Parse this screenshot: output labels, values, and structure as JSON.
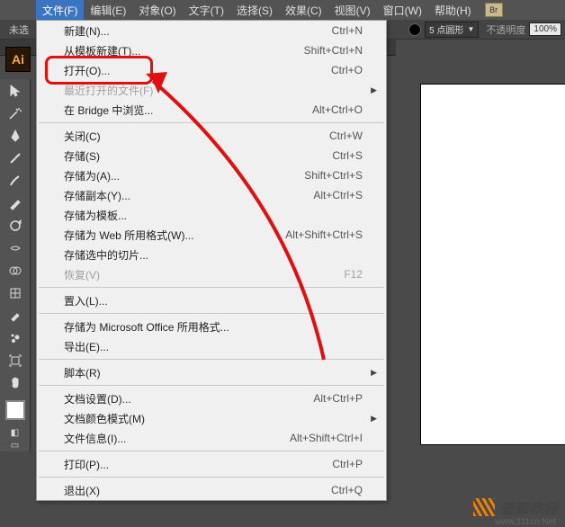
{
  "app_icon": "Ai",
  "menubar": {
    "items": [
      "文件(F)",
      "编辑(E)",
      "对象(O)",
      "文字(T)",
      "选择(S)",
      "效果(C)",
      "视图(V)",
      "窗口(W)",
      "帮助(H)"
    ],
    "badge": "Br"
  },
  "top_left": "未选",
  "brush": {
    "label": "5 点圆形"
  },
  "opacity": {
    "label": "不透明度",
    "value": "100%"
  },
  "menu": [
    {
      "type": "item",
      "label": "新建(N)...",
      "shortcut": "Ctrl+N"
    },
    {
      "type": "item",
      "label": "从模板新建(T)...",
      "shortcut": "Shift+Ctrl+N"
    },
    {
      "type": "item",
      "label": "打开(O)...",
      "shortcut": "Ctrl+O"
    },
    {
      "type": "item",
      "label": "最近打开的文件(F)",
      "sub": true,
      "disabled": true
    },
    {
      "type": "item",
      "label": "在 Bridge 中浏览...",
      "shortcut": "Alt+Ctrl+O"
    },
    {
      "type": "sep"
    },
    {
      "type": "item",
      "label": "关闭(C)",
      "shortcut": "Ctrl+W"
    },
    {
      "type": "item",
      "label": "存储(S)",
      "shortcut": "Ctrl+S"
    },
    {
      "type": "item",
      "label": "存储为(A)...",
      "shortcut": "Shift+Ctrl+S"
    },
    {
      "type": "item",
      "label": "存储副本(Y)...",
      "shortcut": "Alt+Ctrl+S"
    },
    {
      "type": "item",
      "label": "存储为模板..."
    },
    {
      "type": "item",
      "label": "存储为 Web 所用格式(W)...",
      "shortcut": "Alt+Shift+Ctrl+S"
    },
    {
      "type": "item",
      "label": "存储选中的切片..."
    },
    {
      "type": "item",
      "label": "恢复(V)",
      "shortcut": "F12",
      "disabled": true
    },
    {
      "type": "sep"
    },
    {
      "type": "item",
      "label": "置入(L)..."
    },
    {
      "type": "sep"
    },
    {
      "type": "item",
      "label": "存储为 Microsoft Office 所用格式..."
    },
    {
      "type": "item",
      "label": "导出(E)..."
    },
    {
      "type": "sep"
    },
    {
      "type": "item",
      "label": "脚本(R)",
      "sub": true
    },
    {
      "type": "sep"
    },
    {
      "type": "item",
      "label": "文档设置(D)...",
      "shortcut": "Alt+Ctrl+P"
    },
    {
      "type": "item",
      "label": "文档颜色模式(M)",
      "sub": true
    },
    {
      "type": "item",
      "label": "文件信息(I)...",
      "shortcut": "Alt+Shift+Ctrl+I"
    },
    {
      "type": "sep"
    },
    {
      "type": "item",
      "label": "打印(P)...",
      "shortcut": "Ctrl+P"
    },
    {
      "type": "sep"
    },
    {
      "type": "item",
      "label": "退出(X)",
      "shortcut": "Ctrl+Q"
    }
  ],
  "watermark": {
    "brand": "壹聚教程",
    "url": "www.111cn.Net"
  }
}
